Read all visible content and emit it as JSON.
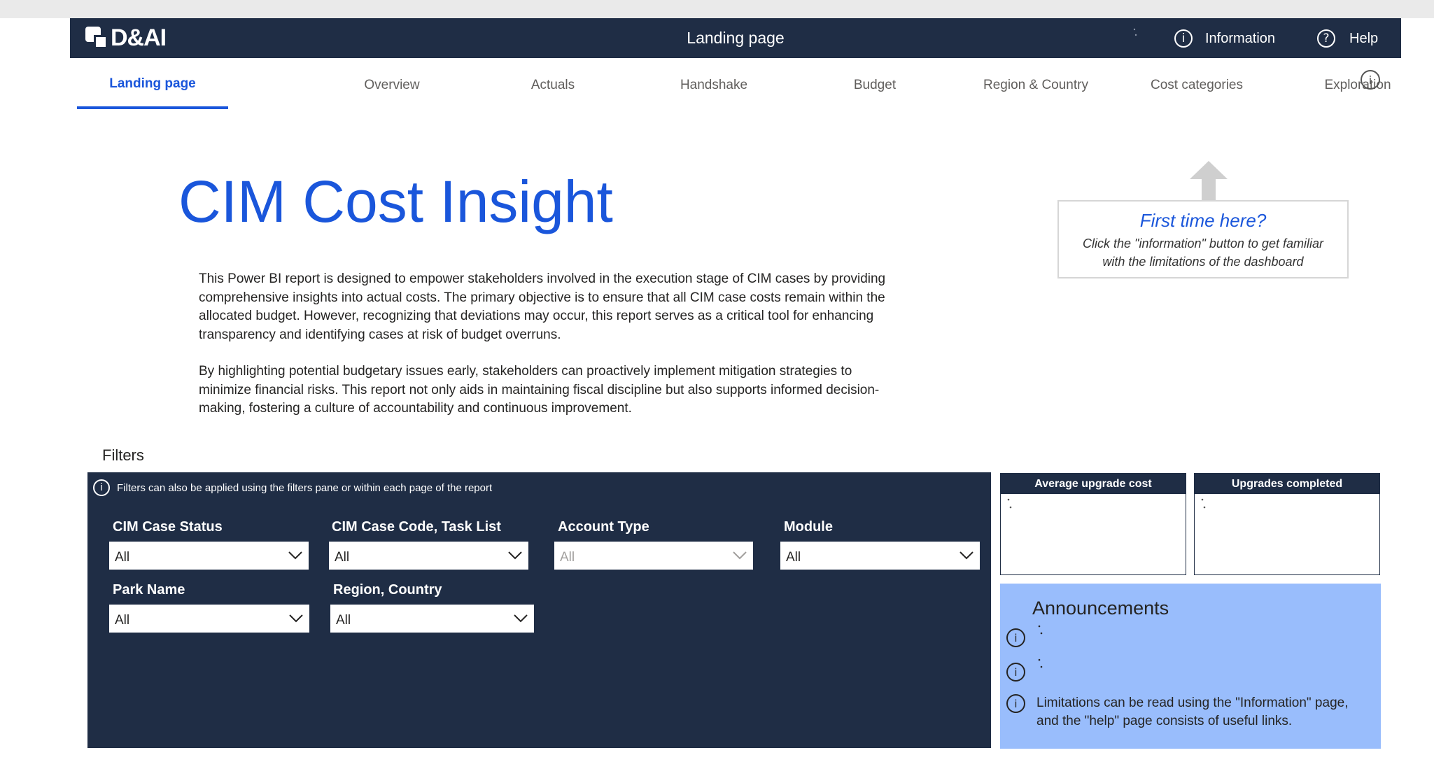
{
  "header": {
    "logo_text": "D&AI",
    "title": "Landing page",
    "information_label": "Information",
    "help_label": "Help",
    "info_glyph": "i",
    "help_glyph": "?"
  },
  "tabs": [
    {
      "label": "Landing page",
      "active": true
    },
    {
      "label": "Overview"
    },
    {
      "label": "Actuals"
    },
    {
      "label": "Handshake"
    },
    {
      "label": "Budget"
    },
    {
      "label": "Region & Country"
    },
    {
      "label": "Cost categories"
    },
    {
      "label": "Exploration"
    }
  ],
  "main": {
    "title": "CIM Cost Insight",
    "paragraphs": [
      "This Power BI report is designed to empower stakeholders involved in the execution stage of CIM cases by providing comprehensive insights into actual costs. The primary objective is to ensure that all CIM case costs remain within the allocated budget. However, recognizing that deviations may occur, this report serves as a critical tool for enhancing transparency and identifying cases at risk of budget overruns.",
      "By highlighting potential budgetary issues early, stakeholders can proactively implement mitigation strategies to minimize financial risks. This report not only aids in maintaining fiscal discipline but also supports informed decision-making, fostering a culture of accountability and continuous improvement."
    ]
  },
  "first_time": {
    "title": "First time here?",
    "body_line1": "Click the \"information\" button to get familiar",
    "body_line2": "with the limitations of the dashboard"
  },
  "filters": {
    "section_label": "Filters",
    "note": "Filters can also be applied using the filters pane or within each page of the report",
    "items": [
      {
        "label": "CIM Case Status",
        "value": "All"
      },
      {
        "label": "CIM Case Code, Task List",
        "value": "All"
      },
      {
        "label": "Account Type",
        "value": "All",
        "disabled": true
      },
      {
        "label": "Module",
        "value": "All"
      },
      {
        "label": "Park Name",
        "value": "All"
      },
      {
        "label": "Region, Country",
        "value": "All"
      }
    ]
  },
  "kpis": {
    "avg_upgrade_cost": "Average upgrade cost",
    "upgrades_completed": "Upgrades completed"
  },
  "announcements": {
    "title": "Announcements",
    "text_line1": "Limitations can be read using the \"Information\" page,",
    "text_line2": "and the \"help\" page consists of useful links."
  },
  "colors": {
    "navy": "#1f2d45",
    "accent_blue": "#1a56db",
    "announcement_bg": "#99bdfc"
  }
}
